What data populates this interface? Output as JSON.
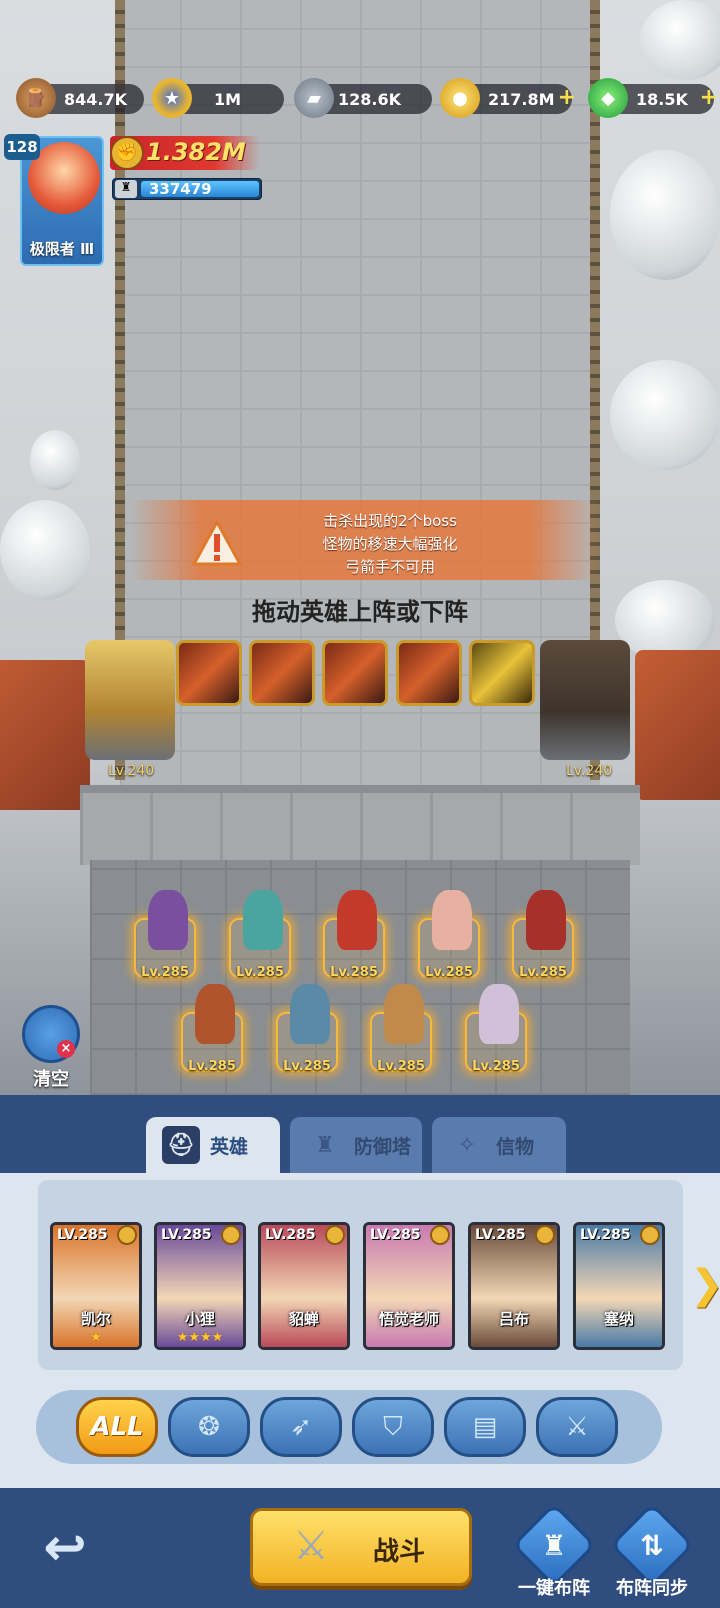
{
  "resources": [
    {
      "icon": "wood-icon",
      "value": "844.7K",
      "plus": false
    },
    {
      "icon": "star-medal-icon",
      "value": "1M",
      "plus": false
    },
    {
      "icon": "iron-ore-icon",
      "value": "128.6K",
      "plus": false
    },
    {
      "icon": "gold-coin-icon",
      "value": "217.8M",
      "plus": true
    },
    {
      "icon": "green-gem-icon",
      "value": "18.5K",
      "plus": true
    }
  ],
  "player": {
    "level": "128",
    "rank": "极限者 Ⅲ",
    "power": "1.382M",
    "castle_hp": "337479"
  },
  "mission": {
    "lines": [
      "击杀出现的2个boss",
      "怪物的移速大幅强化",
      "弓箭手不可用"
    ]
  },
  "hint": "拖动英雄上阵或下阵",
  "towers": {
    "left_level": "Lv.240",
    "right_level": "Lv.240"
  },
  "field_heroes": [
    {
      "level": "Lv.285",
      "color": "#7a4fa0"
    },
    {
      "level": "Lv.285",
      "color": "#4aa5a0"
    },
    {
      "level": "Lv.285",
      "color": "#c43a2a"
    },
    {
      "level": "Lv.285",
      "color": "#e8b0a0"
    },
    {
      "level": "Lv.285",
      "color": "#a8302a"
    },
    {
      "level": "Lv.285",
      "color": "#b0542e"
    },
    {
      "level": "Lv.285",
      "color": "#5a8aa6"
    },
    {
      "level": "Lv.285",
      "color": "#c08a4a"
    },
    {
      "level": "Lv.285",
      "color": "#d0c0d8"
    }
  ],
  "clear_label": "清空",
  "tabs": [
    {
      "label": "英雄",
      "icon": "helmet-icon",
      "active": true
    },
    {
      "label": "防御塔",
      "icon": "tower-icon",
      "active": false
    },
    {
      "label": "信物",
      "icon": "relic-icon",
      "active": false
    }
  ],
  "hero_cards": [
    {
      "level": "LV.285",
      "name": "凯尔",
      "stars": "★",
      "color": "#d9742a"
    },
    {
      "level": "LV.285",
      "name": "小狸",
      "stars": "★★★★",
      "color": "#6a4a9a"
    },
    {
      "level": "LV.285",
      "name": "貂蝉",
      "stars": "",
      "color": "#b84a5a"
    },
    {
      "level": "LV.285",
      "name": "悟觉老师",
      "stars": "",
      "color": "#c87ab0"
    },
    {
      "level": "LV.285",
      "name": "吕布",
      "stars": "",
      "color": "#6a4a3a"
    },
    {
      "level": "LV.285",
      "name": "塞纳",
      "stars": "",
      "color": "#4a7aa6"
    }
  ],
  "filters": [
    {
      "label": "ALL",
      "icon": ""
    },
    {
      "label": "",
      "icon": "mage-icon"
    },
    {
      "label": "",
      "icon": "archer-icon"
    },
    {
      "label": "",
      "icon": "shield-icon"
    },
    {
      "label": "",
      "icon": "book-icon"
    },
    {
      "label": "",
      "icon": "sword-icon"
    }
  ],
  "bottom": {
    "fight_label": "战斗",
    "auto_deploy_label": "一键布阵",
    "sync_label": "布阵同步"
  }
}
